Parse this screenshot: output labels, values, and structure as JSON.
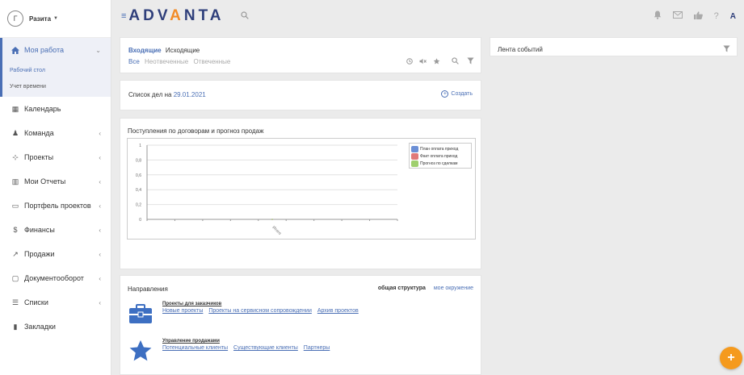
{
  "user": {
    "initial": "Г",
    "name": "Разита",
    "caret": "▼"
  },
  "topbar": {
    "menu_icon": "≡",
    "logo_left": "ADV",
    "logo_accent": "A",
    "logo_right": "NTA",
    "search_icon": "🔍",
    "icons": [
      "bell-icon",
      "mail-icon",
      "like-icon",
      "help-icon"
    ],
    "help_text": "?",
    "brand_badge": "A"
  },
  "sidebar": {
    "active": {
      "label": "Моя работа",
      "icon": "home-icon"
    },
    "subitems": [
      {
        "label": "Рабочий стол",
        "active": true
      },
      {
        "label": "Учет времени",
        "active": false
      }
    ],
    "items": [
      {
        "label": "Календарь",
        "icon": "calendar-icon",
        "glyph": "▦",
        "chevron": false
      },
      {
        "label": "Команда",
        "icon": "team-icon",
        "glyph": "♟",
        "chevron": true
      },
      {
        "label": "Проекты",
        "icon": "projects-icon",
        "glyph": "⊹",
        "chevron": true
      },
      {
        "label": "Мои Отчеты",
        "icon": "reports-icon",
        "glyph": "▥",
        "chevron": true
      },
      {
        "label": "Портфель проектов",
        "icon": "portfolio-icon",
        "glyph": "▭",
        "chevron": true
      },
      {
        "label": "Финансы",
        "icon": "finance-icon",
        "glyph": "$",
        "chevron": true
      },
      {
        "label": "Продажи",
        "icon": "sales-icon",
        "glyph": "↗",
        "chevron": true
      },
      {
        "label": "Документооборот",
        "icon": "documents-icon",
        "glyph": "▢",
        "chevron": true
      },
      {
        "label": "Списки",
        "icon": "lists-icon",
        "glyph": "☰",
        "chevron": true
      },
      {
        "label": "Закладки",
        "icon": "bookmark-icon",
        "glyph": "▮",
        "chevron": false
      }
    ]
  },
  "inbox": {
    "tab_active": "Входящие",
    "tab_other": "Исходящие",
    "filters": [
      "Все",
      "Неотвеченные",
      "Отвеченные"
    ],
    "tools": [
      "clock-icon",
      "mute-icon",
      "star-icon",
      "search-icon",
      "filter-icon"
    ]
  },
  "todo": {
    "label": "Список дел на",
    "date": "29.01.2021",
    "create_label": "Создать"
  },
  "chart": {
    "title": "Поступления по договорам и прогноз продаж"
  },
  "chart_data": {
    "type": "line",
    "title": "Поступления по договорам и прогноз продаж",
    "categories": [
      "Итого"
    ],
    "yticks": [
      "1",
      "0,8",
      "0,6",
      "0,4",
      "0,2",
      "0"
    ],
    "ylim": [
      0,
      1
    ],
    "grid": true,
    "legend_placement": "top-right",
    "series": [
      {
        "name": "План оплата приход",
        "color": "#6b8fd6",
        "values": [
          0
        ]
      },
      {
        "name": "Факт оплата приход",
        "color": "#e07a7a",
        "values": [
          0
        ]
      },
      {
        "name": "Прогноз по сделкам",
        "color": "#9fcf6e",
        "values": [
          0
        ]
      }
    ]
  },
  "directions": {
    "title": "Направления",
    "switch_selected": "общая структура",
    "switch_other": "мое окружение",
    "groups": [
      {
        "name": "Проекты для заказчиков",
        "icon": "briefcase-icon",
        "links": [
          "Новые проекты",
          "Проекты на сервисном сопровождении",
          "Архив проектов"
        ]
      },
      {
        "name": "Управление продажами",
        "icon": "star-icon",
        "links": [
          "Потенциальные клиенты",
          "Существующие клиенты",
          "Партнеры"
        ]
      }
    ]
  },
  "events": {
    "title": "Лента событий"
  },
  "fab": {
    "label": "+"
  },
  "colors": {
    "accent": "#4a6fb5",
    "brand": "#2f3f7b",
    "fab": "#f59a1d"
  }
}
